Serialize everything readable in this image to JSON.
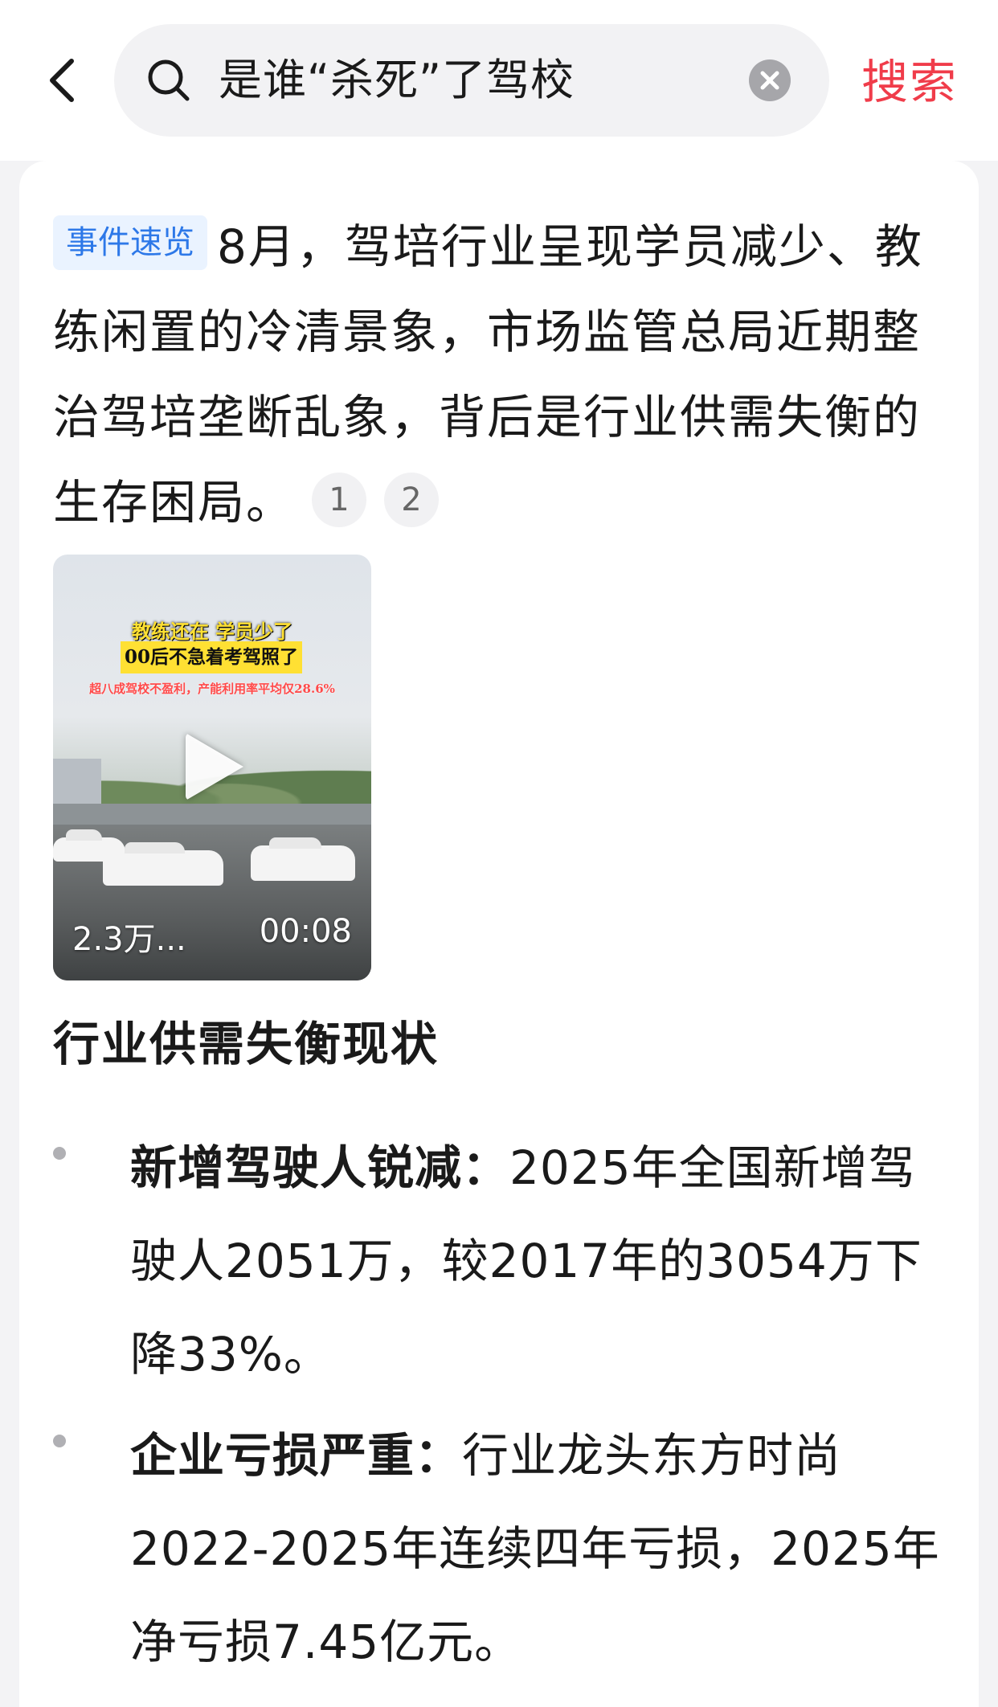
{
  "header": {
    "search_query": "是谁“杀死”了驾校",
    "search_button": "搜索"
  },
  "summary": {
    "tag": "事件速览",
    "text": "8月，驾培行业呈现学员减少、教练闲置的冷清景象，市场监管总局近期整治驾培垄断乱象，背后是行业供需失衡的生存困局。",
    "refs": [
      "1",
      "2"
    ]
  },
  "video": {
    "caption_line1": "教练还在 学员少了",
    "caption_line2": "00后不急着考驾照了",
    "caption_line3": "超八成驾校不盈利，产能利用率平均仅28.6%",
    "views": "2.3万...",
    "duration": "00:08"
  },
  "section": {
    "title": "行业供需失衡现状",
    "items": [
      {
        "head": "新增驾驶人锐减：",
        "body": "2025年全国新增驾驶人2051万，较2017年的3054万下降33%。"
      },
      {
        "head": "企业亏损严重：",
        "body": "行业龙头东方时尚2022-2025年连续四年亏损，2025年净亏损7.45亿元。"
      }
    ]
  },
  "colors": {
    "accent_red": "#f03c4a",
    "tag_blue": "#2d78e8",
    "tag_bg": "#eaf3ff"
  }
}
